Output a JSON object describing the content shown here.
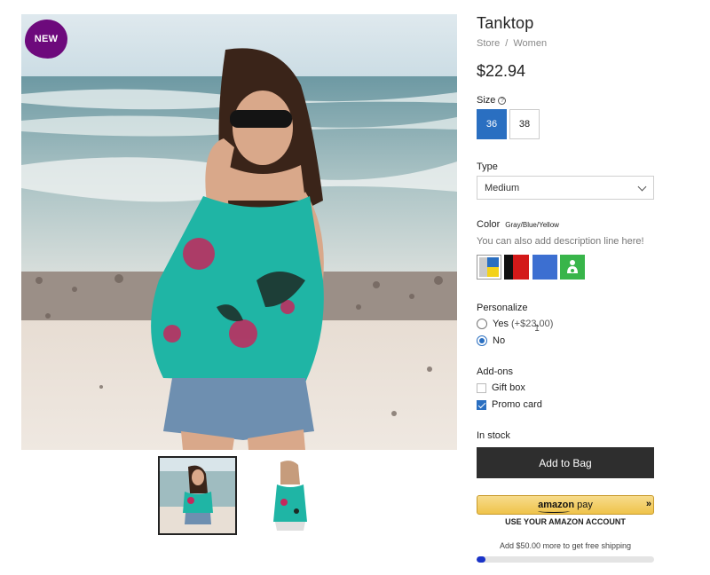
{
  "badge": "NEW",
  "product": {
    "title": "Tanktop",
    "breadcrumb": [
      "Store",
      "/",
      "Women"
    ],
    "price": "$22.94"
  },
  "size": {
    "label": "Size",
    "info_icon": "info-icon",
    "options": [
      "36",
      "38"
    ],
    "selected": "36"
  },
  "type": {
    "label": "Type",
    "selected": "Medium"
  },
  "color": {
    "label": "Color",
    "value": "Gray/Blue/Yellow",
    "description": "You can also add description line here!",
    "swatches": [
      {
        "name": "gray-blue-yellow",
        "colors": [
          "#c9c9c9",
          "#2a6fc1",
          "#f3d21a"
        ]
      },
      {
        "name": "black-red",
        "colors": [
          "#111111",
          "#d31919"
        ]
      },
      {
        "name": "blue",
        "colors": [
          "#3c6fd1"
        ]
      },
      {
        "name": "green-person",
        "colors": [
          "#38b54a"
        ]
      }
    ]
  },
  "personalize": {
    "label": "Personalize",
    "options": [
      {
        "label": "Yes",
        "extra": "(+$23.00)",
        "selected": false
      },
      {
        "label": "No",
        "selected": true
      }
    ]
  },
  "addons": {
    "label": "Add-ons",
    "options": [
      {
        "label": "Gift box",
        "checked": false
      },
      {
        "label": "Promo card",
        "checked": true
      }
    ]
  },
  "stock": "In stock",
  "add_to_bag": "Add to Bag",
  "amazon": {
    "logo": "amazon",
    "pay": "pay",
    "arrows": "»",
    "subtext": "USE YOUR AMAZON ACCOUNT"
  },
  "shipping": {
    "text": "Add $50.00 more to get free shipping",
    "progress": 0.05
  },
  "colors": {
    "accent": "#2a6fc1",
    "badge": "#6d0a7c",
    "button_dark": "#2e2e2e",
    "progress_fill": "#1a33c8"
  }
}
